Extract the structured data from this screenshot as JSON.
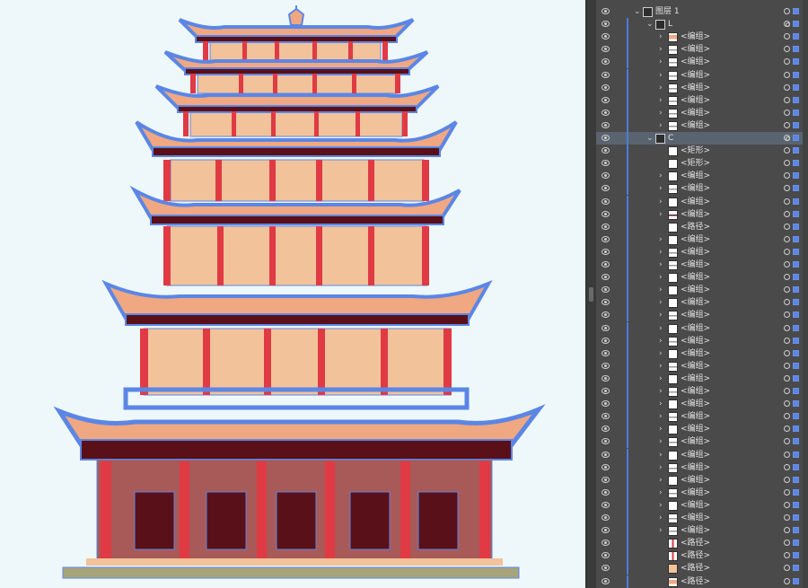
{
  "canvas": {
    "background": "#eef8fb",
    "artwork": "pagoda-illustration",
    "colors": {
      "wall": "#f2c29a",
      "pillar": "#e03a44",
      "roof_outline": "#5b86e5",
      "roof_tiles": "#f0a882",
      "door": "#5a1018",
      "base": "#a8a47a"
    }
  },
  "layers_panel": {
    "rows": [
      {
        "name": "图层 1",
        "chevron": "⌄",
        "thumb": "top-layer",
        "target": "single",
        "sel": "filled",
        "selected": false
      },
      {
        "name": "L",
        "chevron": "⌄",
        "thumb": "L-group",
        "target": "double",
        "sel": "filled",
        "selected": false
      },
      {
        "name": "<编组>",
        "chevron": "›",
        "thumb": "roof-finial",
        "target": "single",
        "sel": "filled",
        "selected": false
      },
      {
        "name": "<编组>",
        "chevron": "›",
        "thumb": "stripe",
        "target": "single",
        "sel": "filled",
        "selected": false
      },
      {
        "name": "<编组>",
        "chevron": "›",
        "thumb": "stripe",
        "target": "single",
        "sel": "filled",
        "selected": false
      },
      {
        "name": "<编组>",
        "chevron": "›",
        "thumb": "stripe",
        "target": "single",
        "sel": "filled",
        "selected": false
      },
      {
        "name": "<编组>",
        "chevron": "›",
        "thumb": "stripe",
        "target": "single",
        "sel": "filled",
        "selected": false
      },
      {
        "name": "<编组>",
        "chevron": "›",
        "thumb": "stripe",
        "target": "single",
        "sel": "filled",
        "selected": false
      },
      {
        "name": "<编组>",
        "chevron": "›",
        "thumb": "stripe",
        "target": "single",
        "sel": "filled",
        "selected": false
      },
      {
        "name": "<编组>",
        "chevron": "›",
        "thumb": "stripe",
        "target": "single",
        "sel": "filled",
        "selected": false
      },
      {
        "name": "C",
        "chevron": "⌄",
        "thumb": "C-group",
        "target": "double",
        "sel": "filled",
        "selected": true
      },
      {
        "name": "<矩形>",
        "chevron": "",
        "thumb": "blank",
        "target": "single",
        "sel": "filled",
        "selected": false
      },
      {
        "name": "<矩形>",
        "chevron": "",
        "thumb": "blank",
        "target": "single",
        "sel": "filled",
        "selected": false
      },
      {
        "name": "<编组>",
        "chevron": "›",
        "thumb": "dots",
        "target": "single",
        "sel": "filled",
        "selected": false
      },
      {
        "name": "<编组>",
        "chevron": "›",
        "thumb": "stripe",
        "target": "single",
        "sel": "filled",
        "selected": false
      },
      {
        "name": "<编组>",
        "chevron": "›",
        "thumb": "dots",
        "target": "single",
        "sel": "filled",
        "selected": false
      },
      {
        "name": "<编组>",
        "chevron": "›",
        "thumb": "dark-stripe",
        "target": "single",
        "sel": "filled",
        "selected": false
      },
      {
        "name": "<路径>",
        "chevron": "",
        "thumb": "blank",
        "target": "single",
        "sel": "filled",
        "selected": false
      },
      {
        "name": "<编组>",
        "chevron": "›",
        "thumb": "dots",
        "target": "single",
        "sel": "filled",
        "selected": false
      },
      {
        "name": "<编组>",
        "chevron": "›",
        "thumb": "stripe",
        "target": "single",
        "sel": "filled",
        "selected": false
      },
      {
        "name": "<编组>",
        "chevron": "›",
        "thumb": "stripe",
        "target": "single",
        "sel": "filled",
        "selected": false
      },
      {
        "name": "<编组>",
        "chevron": "›",
        "thumb": "dots",
        "target": "single",
        "sel": "filled",
        "selected": false
      },
      {
        "name": "<编组>",
        "chevron": "›",
        "thumb": "dots",
        "target": "single",
        "sel": "filled",
        "selected": false
      },
      {
        "name": "<编组>",
        "chevron": "›",
        "thumb": "dots",
        "target": "single",
        "sel": "filled",
        "selected": false
      },
      {
        "name": "<编组>",
        "chevron": "›",
        "thumb": "stripe",
        "target": "single",
        "sel": "filled",
        "selected": false
      },
      {
        "name": "<编组>",
        "chevron": "›",
        "thumb": "dots",
        "target": "single",
        "sel": "filled",
        "selected": false
      },
      {
        "name": "<编组>",
        "chevron": "›",
        "thumb": "stripe",
        "target": "single",
        "sel": "filled",
        "selected": false
      },
      {
        "name": "<编组>",
        "chevron": "›",
        "thumb": "dots",
        "target": "single",
        "sel": "filled",
        "selected": false
      },
      {
        "name": "<编组>",
        "chevron": "›",
        "thumb": "stripe",
        "target": "single",
        "sel": "filled",
        "selected": false
      },
      {
        "name": "<编组>",
        "chevron": "›",
        "thumb": "dots",
        "target": "single",
        "sel": "filled",
        "selected": false
      },
      {
        "name": "<编组>",
        "chevron": "›",
        "thumb": "stripe",
        "target": "single",
        "sel": "filled",
        "selected": false
      },
      {
        "name": "<编组>",
        "chevron": "›",
        "thumb": "dots",
        "target": "single",
        "sel": "filled",
        "selected": false
      },
      {
        "name": "<编组>",
        "chevron": "›",
        "thumb": "stripe",
        "target": "single",
        "sel": "filled",
        "selected": false
      },
      {
        "name": "<编组>",
        "chevron": "›",
        "thumb": "dots",
        "target": "single",
        "sel": "filled",
        "selected": false
      },
      {
        "name": "<编组>",
        "chevron": "›",
        "thumb": "stripe",
        "target": "single",
        "sel": "filled",
        "selected": false
      },
      {
        "name": "<编组>",
        "chevron": "›",
        "thumb": "dots",
        "target": "single",
        "sel": "filled",
        "selected": false
      },
      {
        "name": "<编组>",
        "chevron": "›",
        "thumb": "stripe",
        "target": "single",
        "sel": "filled",
        "selected": false
      },
      {
        "name": "<编组>",
        "chevron": "›",
        "thumb": "dots",
        "target": "single",
        "sel": "filled",
        "selected": false
      },
      {
        "name": "<编组>",
        "chevron": "›",
        "thumb": "stripe",
        "target": "single",
        "sel": "filled",
        "selected": false
      },
      {
        "name": "<编组>",
        "chevron": "›",
        "thumb": "dots",
        "target": "single",
        "sel": "filled",
        "selected": false
      },
      {
        "name": "<编组>",
        "chevron": "›",
        "thumb": "stripe",
        "target": "single",
        "sel": "filled",
        "selected": false
      },
      {
        "name": "<编组>",
        "chevron": "›",
        "thumb": "stripe",
        "target": "single",
        "sel": "filled",
        "selected": false
      },
      {
        "name": "<路径>",
        "chevron": "",
        "thumb": "red-bar",
        "target": "single",
        "sel": "filled",
        "selected": false
      },
      {
        "name": "<路径>",
        "chevron": "",
        "thumb": "red-bars",
        "target": "single",
        "sel": "filled",
        "selected": false
      },
      {
        "name": "<路径>",
        "chevron": "",
        "thumb": "peach",
        "target": "single",
        "sel": "filled",
        "selected": false
      },
      {
        "name": "<路径>",
        "chevron": "",
        "thumb": "pagoda",
        "target": "single",
        "sel": "filled",
        "selected": false
      }
    ]
  }
}
